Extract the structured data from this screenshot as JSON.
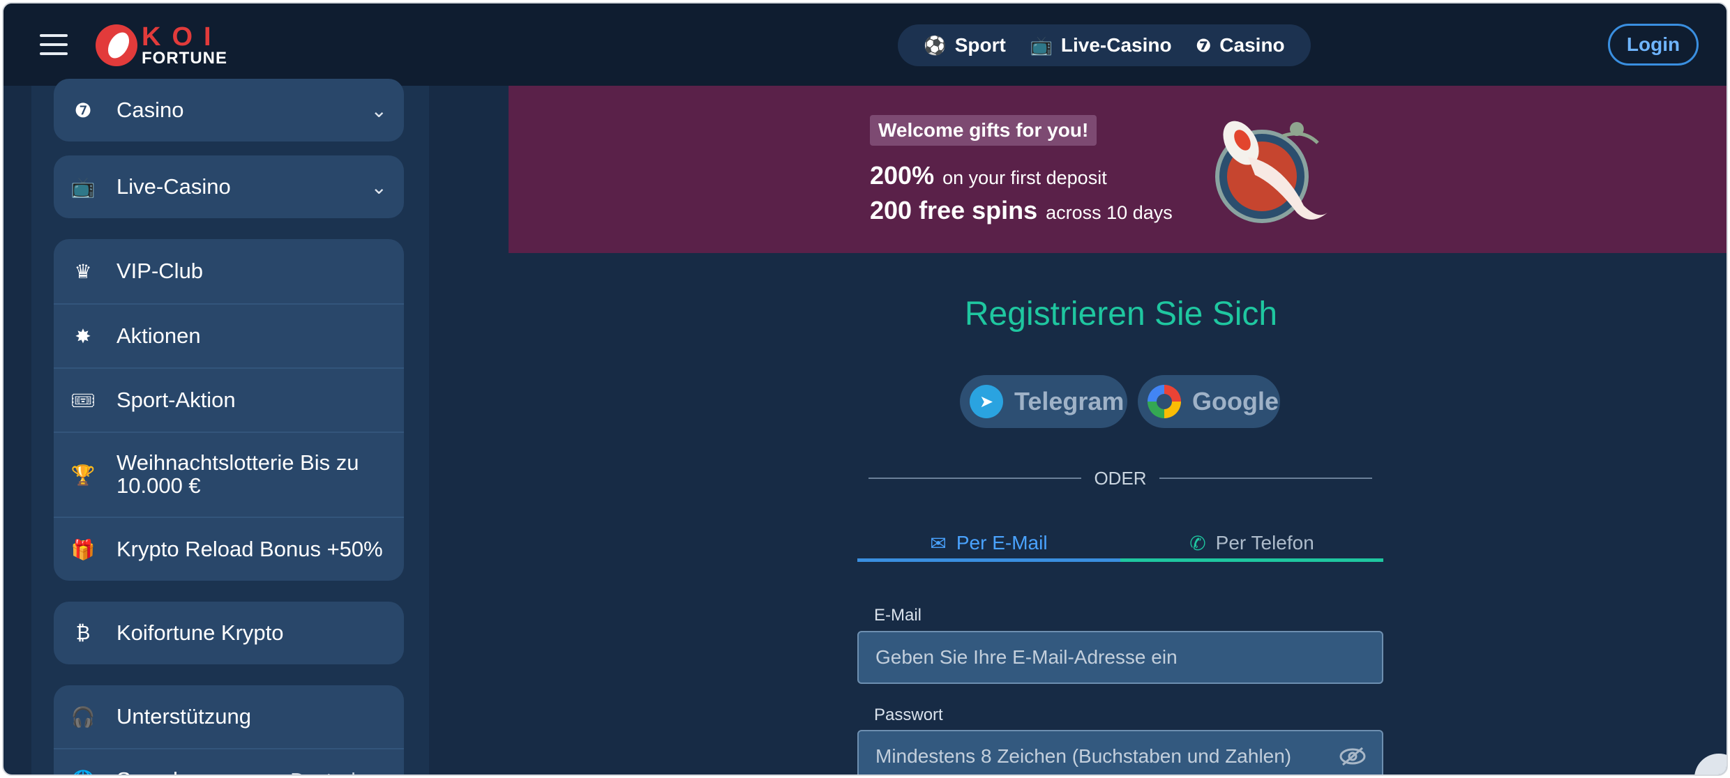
{
  "header": {
    "logo_koi": "KOI",
    "logo_fortune": "FORTUNE",
    "nav": [
      {
        "label": "Sport",
        "icon": "soccer-ball-icon"
      },
      {
        "label": "Live-Casino",
        "icon": "live-tv-icon"
      },
      {
        "label": "Casino",
        "icon": "slot-seven-icon"
      }
    ],
    "login_label": "Login"
  },
  "sidebar": {
    "casino": {
      "label": "Casino",
      "icon": "slot-seven-icon"
    },
    "live_casino": {
      "label": "Live-Casino",
      "icon": "live-tv-icon"
    },
    "menu": [
      {
        "label": "VIP-Club",
        "icon": "crown-icon"
      },
      {
        "label": "Aktionen",
        "icon": "star-burst-icon"
      },
      {
        "label": "Sport-Aktion",
        "icon": "ticket-icon"
      },
      {
        "label": "Weihnachtslotterie Bis zu 10.000 €",
        "icon": "trophy-icon"
      },
      {
        "label": "Krypto Reload Bonus +50%",
        "icon": "gift-icon"
      }
    ],
    "krypto": {
      "label": "Koifortune Krypto",
      "icon": "bitcoin-icon"
    },
    "support": {
      "label": "Unterstützung",
      "icon": "headset-icon"
    },
    "language": {
      "label": "Sprache",
      "value": "Deutsch",
      "icon": "globe-icon"
    }
  },
  "banner": {
    "badge": "Welcome gifts for you!",
    "line1_big": "200%",
    "line1_small": "on your first deposit",
    "line2_big": "200 free spins",
    "line2_small": "across 10 days"
  },
  "register": {
    "title": "Registrieren Sie Sich",
    "telegram_label": "Telegram",
    "google_label": "Google",
    "oder": "ODER",
    "tab_email": "Per E-Mail",
    "tab_phone": "Per Telefon",
    "email_label": "E-Mail",
    "email_placeholder": "Geben Sie Ihre E-Mail-Adresse ein",
    "password_label": "Passwort",
    "password_placeholder": "Mindestens 8 Zeichen (Buchstaben und Zahlen)"
  },
  "colors": {
    "accent_teal": "#1fc7a0",
    "accent_blue": "#3a8fe0",
    "banner_bg": "#5a2149",
    "brand_red": "#e23b3b"
  }
}
